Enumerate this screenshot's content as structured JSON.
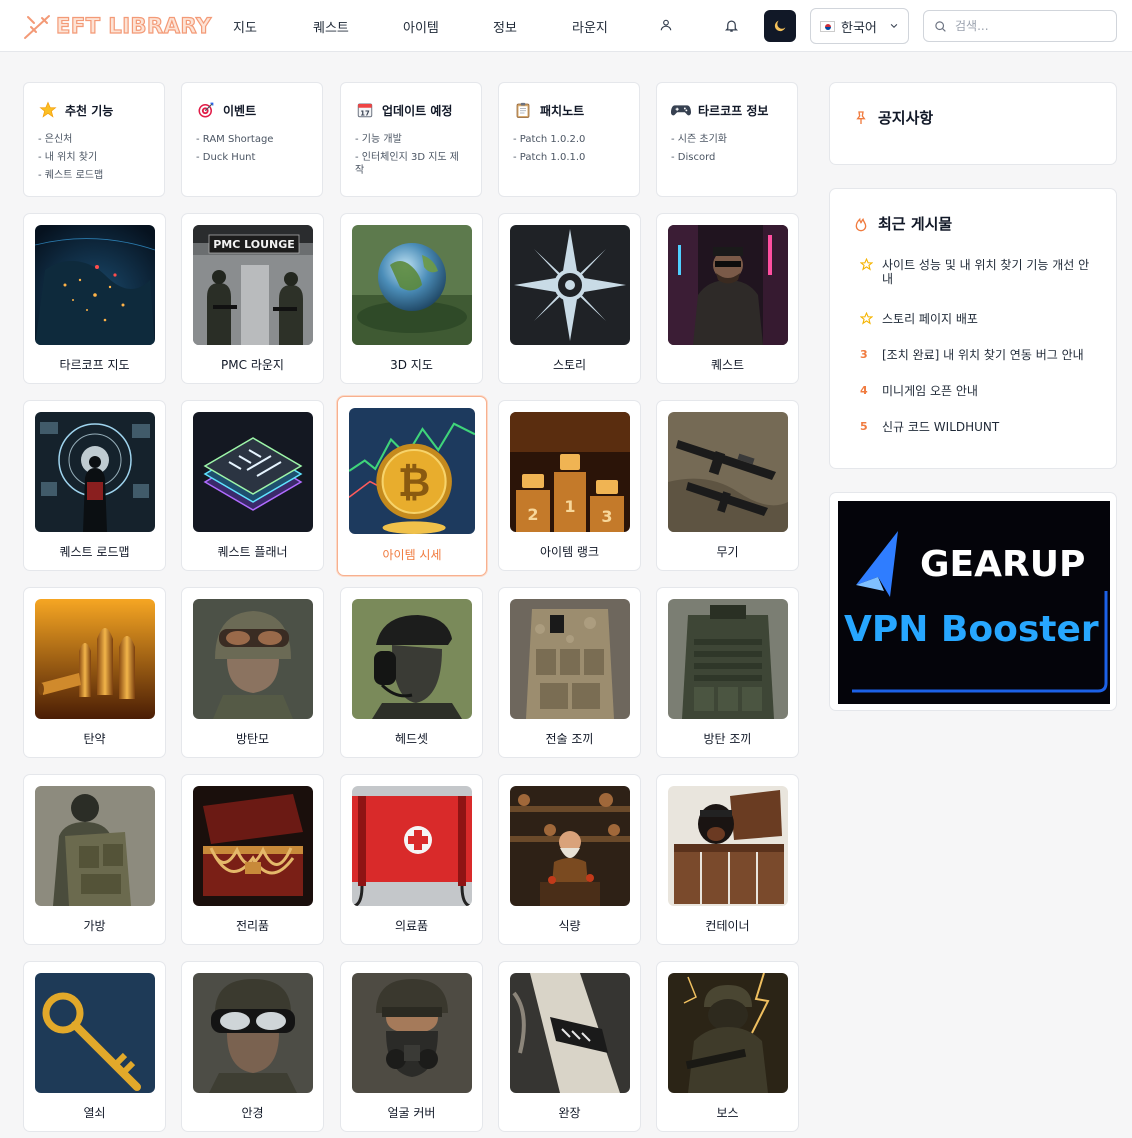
{
  "brand": {
    "name": "EFT LIBRARY"
  },
  "nav": [
    {
      "label": "지도"
    },
    {
      "label": "퀘스트"
    },
    {
      "label": "아이템"
    },
    {
      "label": "정보"
    },
    {
      "label": "라운지"
    }
  ],
  "language": {
    "selected": "한국어"
  },
  "search": {
    "placeholder": "검색..."
  },
  "info_cards": [
    {
      "title": "추천 기능",
      "icon": "star-icon",
      "items": [
        "- 은신처",
        "- 내 위치 찾기",
        "- 퀘스트 로드맵"
      ]
    },
    {
      "title": "이벤트",
      "icon": "target-icon",
      "items": [
        "- RAM Shortage",
        "- Duck Hunt"
      ]
    },
    {
      "title": "업데이트 예정",
      "icon": "calendar-icon",
      "items": [
        "- 기능 개발",
        "- 인터체인지 3D 지도 제작"
      ]
    },
    {
      "title": "패치노트",
      "icon": "clipboard-icon",
      "items": [
        "- Patch 1.0.2.0",
        "- Patch 1.0.1.0"
      ]
    },
    {
      "title": "타르코프 정보",
      "icon": "gamepad-icon",
      "items": [
        "- 시즌 초기화",
        "- Discord"
      ]
    }
  ],
  "tiles": [
    {
      "label": "타르코프 지도"
    },
    {
      "label": "PMC 라운지",
      "image_text": "PMC LOUNGE"
    },
    {
      "label": "3D 지도"
    },
    {
      "label": "스토리"
    },
    {
      "label": "퀘스트"
    },
    {
      "label": "퀘스트 로드맵"
    },
    {
      "label": "퀘스트 플래너"
    },
    {
      "label": "아이템 시세",
      "active": true
    },
    {
      "label": "아이템 랭크"
    },
    {
      "label": "무기"
    },
    {
      "label": "탄약"
    },
    {
      "label": "방탄모"
    },
    {
      "label": "헤드셋"
    },
    {
      "label": "전술 조끼"
    },
    {
      "label": "방탄 조끼"
    },
    {
      "label": "가방"
    },
    {
      "label": "전리품"
    },
    {
      "label": "의료품"
    },
    {
      "label": "식량"
    },
    {
      "label": "컨테이너"
    },
    {
      "label": "열쇠"
    },
    {
      "label": "안경"
    },
    {
      "label": "얼굴 커버"
    },
    {
      "label": "완장"
    },
    {
      "label": "보스"
    }
  ],
  "notices": {
    "title": "공지사항"
  },
  "recent_posts": {
    "title": "최근 게시물",
    "items": [
      {
        "rank": "☆",
        "text": "사이트 성능 및 내 위치 찾기 기능 개선 안내"
      },
      {
        "rank": "☆",
        "text": "스토리 페이지 배포"
      },
      {
        "rank": "3",
        "text": "[조치 완료] 내 위치 찾기 연동 버그 안내"
      },
      {
        "rank": "4",
        "text": "미니게임 오픈 안내"
      },
      {
        "rank": "5",
        "text": "신규 코드 WILDHUNT"
      }
    ]
  },
  "ad": {
    "line1": "GEARUP",
    "line2": "VPN Booster"
  },
  "colors": {
    "accent": "#f07b3f",
    "border": "#e5e7eb",
    "background": "#f6f6f7"
  }
}
